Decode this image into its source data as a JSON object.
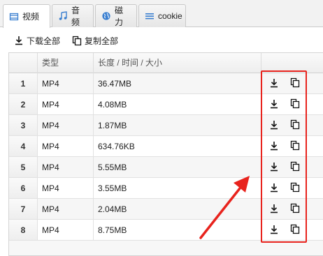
{
  "tabs": [
    {
      "label": "视频",
      "icon": "video-icon"
    },
    {
      "label": "音频",
      "icon": "music-note-icon"
    },
    {
      "label": "磁力",
      "icon": "globe-icon"
    },
    {
      "label": "cookie",
      "icon": "list-icon"
    }
  ],
  "toolbar": {
    "download_all": "下载全部",
    "copy_all": "复制全部"
  },
  "table": {
    "columns": [
      "类型",
      "长度 / 时间 / 大小"
    ],
    "rows": [
      {
        "index": "1",
        "type": "MP4",
        "size": "36.47MB"
      },
      {
        "index": "2",
        "type": "MP4",
        "size": "4.08MB"
      },
      {
        "index": "3",
        "type": "MP4",
        "size": "1.87MB"
      },
      {
        "index": "4",
        "type": "MP4",
        "size": "634.76KB"
      },
      {
        "index": "5",
        "type": "MP4",
        "size": "5.55MB"
      },
      {
        "index": "6",
        "type": "MP4",
        "size": "3.55MB"
      },
      {
        "index": "7",
        "type": "MP4",
        "size": "2.04MB"
      },
      {
        "index": "8",
        "type": "MP4",
        "size": "8.75MB"
      }
    ]
  },
  "colors": {
    "annotation": "#e8231d",
    "tab_icon": "#3a7fd0"
  }
}
